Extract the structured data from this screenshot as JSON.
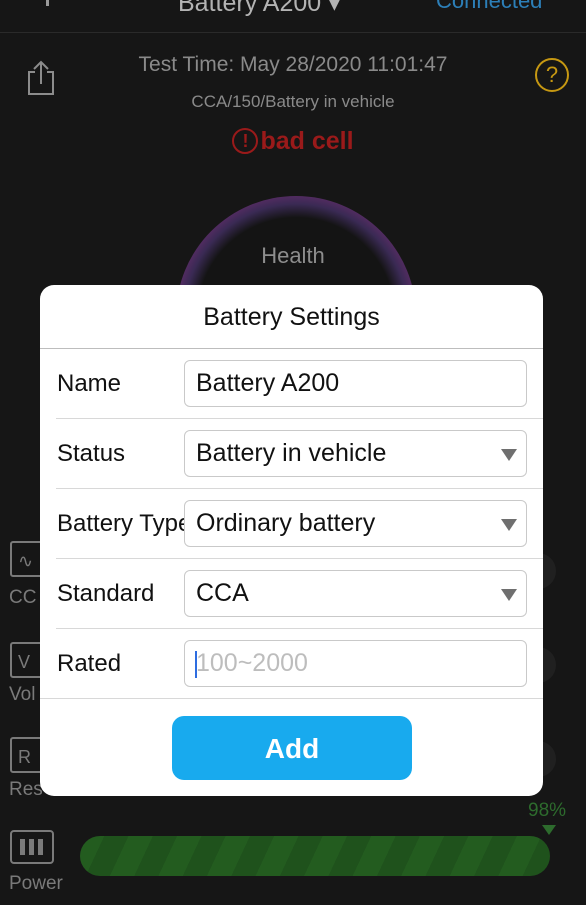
{
  "header": {
    "title": "Battery A200 ▾",
    "connection": "Connected"
  },
  "test": {
    "time": "Test Time:  May 28/2020 11:01:47",
    "summary": "CCA/150/Battery in vehicle",
    "result": "bad cell",
    "result_icon": "!"
  },
  "gauge": {
    "label": "Health"
  },
  "metrics": [
    {
      "label": "CC",
      "icon": "wave-icon",
      "glyph": "∿"
    },
    {
      "label": "Vol",
      "icon": "voltage-icon",
      "glyph": "V"
    },
    {
      "label": "Res",
      "icon": "resistance-icon",
      "glyph": "R"
    }
  ],
  "power": {
    "label": "Power",
    "percent": "98%",
    "level": 0.98
  },
  "dialog": {
    "title": "Battery Settings",
    "rows": [
      {
        "label": "Name",
        "value": "Battery A200",
        "placeholder": "",
        "kind": "text"
      },
      {
        "label": "Status",
        "value": "Battery in vehicle",
        "placeholder": "",
        "kind": "select"
      },
      {
        "label": "Battery Type",
        "value": "Ordinary battery",
        "placeholder": "",
        "kind": "select"
      },
      {
        "label": "Standard",
        "value": "CCA",
        "placeholder": "",
        "kind": "select"
      },
      {
        "label": "Rated",
        "value": "",
        "placeholder": "100~2000",
        "kind": "text"
      }
    ],
    "add_label": "Add"
  },
  "colors": {
    "accent": "#18aaee",
    "bad": "#9a1a1a",
    "power": "#235c1f",
    "help": "#c69812"
  }
}
